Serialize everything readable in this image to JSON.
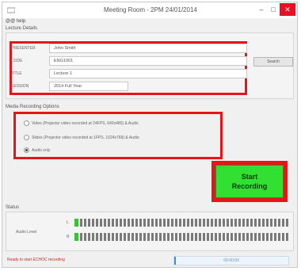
{
  "window": {
    "title": "Meeting Room - 2PM 24/01/2014",
    "min": "–",
    "max": "□",
    "close": "✕"
  },
  "menu": {
    "items": [
      "@@ help"
    ]
  },
  "lecture": {
    "section_label": "Lecture Details",
    "fields": [
      {
        "label": "PRESENTER",
        "value": "John Smith"
      },
      {
        "label": "CODE",
        "value": "ENG1001"
      },
      {
        "label": "TITLE",
        "value": "Lecture 1"
      },
      {
        "label": "SESSION",
        "value": "2014 Full Year"
      }
    ],
    "search_label": "Search"
  },
  "media": {
    "section_label": "Media Recording Options",
    "options": [
      {
        "label": "Video (Projector video recorded at 24FPS, 640x480) & Audio",
        "selected": false
      },
      {
        "label": "Slides (Projector video recorded at 1FPS, 1024x768) & Audio",
        "selected": false
      },
      {
        "label": "Audio only",
        "selected": true
      }
    ]
  },
  "start_button": {
    "line1": "Start",
    "line2": "Recording"
  },
  "status": {
    "section_label": "Status",
    "audio_level_label": "Audio Level",
    "channels": [
      "L",
      "R"
    ]
  },
  "statusbar": {
    "message": "Ready to start ECHOC recording",
    "progress_text": "00:00:00",
    "progress_fraction": 0.01
  },
  "colors": {
    "highlight": "#e8141b",
    "start_green": "#32e032",
    "status_text": "#d0261e",
    "meter_green": "#3bbf3b"
  }
}
